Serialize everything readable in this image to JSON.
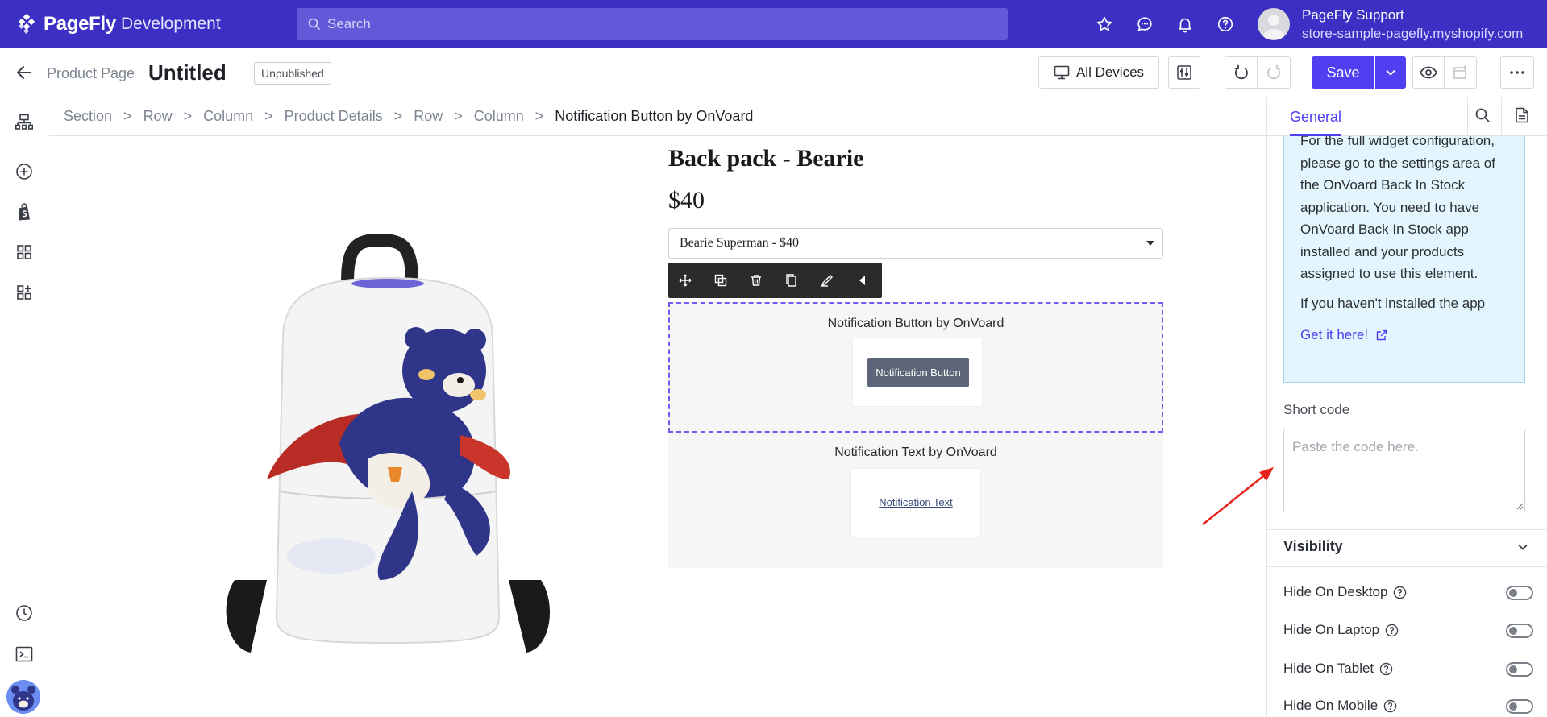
{
  "topbar": {
    "brand": "PageFly",
    "environment": "Development",
    "search_placeholder": "Search",
    "icons": [
      "star-icon",
      "chat-icon",
      "bell-icon",
      "help-icon"
    ],
    "user_name": "PageFly Support",
    "user_store": "store-sample-pagefly.myshopify.com"
  },
  "pagebar": {
    "page_type": "Product Page",
    "page_title": "Untitled",
    "status": "Unpublished",
    "devices_label": "All Devices",
    "save_label": "Save"
  },
  "breadcrumb": [
    "Section",
    "Row",
    "Column",
    "Product Details",
    "Row",
    "Column",
    "Notification Button by OnVoard"
  ],
  "canvas": {
    "product_title": "Back pack - Bearie",
    "product_price": "$40",
    "variant_selected": "Bearie Superman - $40",
    "notif_button_label": "Notification Button by OnVoard",
    "notif_button_text": "Notification Button",
    "notif_text_label": "Notification Text by OnVoard",
    "notif_text_link": "Notification Text"
  },
  "panel": {
    "tab_general": "General",
    "info_text": "For the full widget configuration, please go to the settings area of the OnVoard Back In Stock application. You need to have OnVoard Back In Stock app installed and your products assigned to use this element.",
    "info_text2": "If you haven't installed the app",
    "info_link": "Get it here!",
    "shortcode_label": "Short code",
    "shortcode_placeholder": "Paste the code here.",
    "visibility_title": "Visibility",
    "visibility": [
      {
        "label": "Hide On Desktop",
        "on": false
      },
      {
        "label": "Hide On Laptop",
        "on": false
      },
      {
        "label": "Hide On Tablet",
        "on": false
      },
      {
        "label": "Hide On Mobile",
        "on": false
      }
    ]
  },
  "colors": {
    "topbar": "#3b2fc4",
    "accent": "#4f3ff0",
    "info_bg": "#e4f6fd",
    "annotation": "#e8231c"
  }
}
